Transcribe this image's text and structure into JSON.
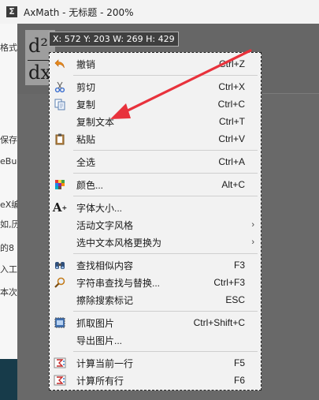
{
  "window": {
    "title": "AxMath - 无标题 - 200%",
    "app_icon_glyph": "Σ"
  },
  "left_fragments": [
    "格式",
    "保存",
    "eBug",
    "eX编",
    "如,历",
    "的8",
    "入工具",
    "本次"
  ],
  "formula": {
    "numerator": "d²",
    "denominator": "dx"
  },
  "coord_tip": "X: 572 Y: 203 W: 269 H: 429",
  "menu": {
    "items": [
      {
        "name": "undo",
        "label": "撤销",
        "shortcut": "Ctrl+Z",
        "icon": "undo-icon"
      },
      {
        "name": "cut",
        "label": "剪切",
        "shortcut": "Ctrl+X",
        "icon": "scissors-icon"
      },
      {
        "name": "copy",
        "label": "复制",
        "shortcut": "Ctrl+C",
        "icon": "copy-icon"
      },
      {
        "name": "copy-text",
        "label": "复制文本",
        "shortcut": "Ctrl+T",
        "icon": ""
      },
      {
        "name": "paste",
        "label": "粘贴",
        "shortcut": "Ctrl+V",
        "icon": "clipboard-icon"
      },
      {
        "name": "select-all",
        "label": "全选",
        "shortcut": "Ctrl+A",
        "icon": ""
      },
      {
        "name": "color",
        "label": "颜色...",
        "shortcut": "Alt+C",
        "icon": "palette-icon"
      },
      {
        "name": "font-size",
        "label": "字体大小...",
        "shortcut": "",
        "icon": "font-size-icon"
      },
      {
        "name": "active-text-style",
        "label": "活动文字风格",
        "shortcut": "",
        "icon": "",
        "submenu": true
      },
      {
        "name": "change-selected-style",
        "label": "选中文本风格更换为",
        "shortcut": "",
        "icon": "",
        "submenu": true
      },
      {
        "name": "find-similar",
        "label": "查找相似内容",
        "shortcut": "F3",
        "icon": "binoculars-icon"
      },
      {
        "name": "find-replace",
        "label": "字符串查找与替换...",
        "shortcut": "Ctrl+F3",
        "icon": "magnifier-icon"
      },
      {
        "name": "erase-search-marks",
        "label": "擦除搜索标记",
        "shortcut": "ESC",
        "icon": ""
      },
      {
        "name": "capture-image",
        "label": "抓取图片",
        "shortcut": "Ctrl+Shift+C",
        "icon": "capture-icon"
      },
      {
        "name": "export-image",
        "label": "导出图片...",
        "shortcut": "",
        "icon": ""
      },
      {
        "name": "calc-current-line",
        "label": "计算当前一行",
        "shortcut": "F5",
        "icon": "calc-icon"
      },
      {
        "name": "calc-all-lines",
        "label": "计算所有行",
        "shortcut": "F6",
        "icon": "calc-icon"
      }
    ],
    "submenu_arrow": "›"
  },
  "colors": {
    "annotation_arrow": "#e8323c",
    "menu_bg": "#f2f2f2",
    "tip_bg": "#3f3f3f"
  }
}
